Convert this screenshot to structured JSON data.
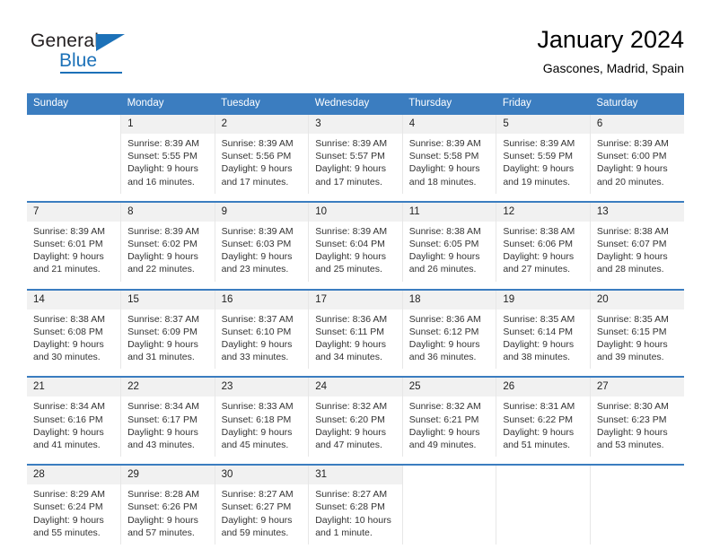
{
  "logo": {
    "word_one": "General",
    "word_two": "Blue"
  },
  "header": {
    "title": "January 2024",
    "subtitle": "Gascones, Madrid, Spain"
  },
  "colors": {
    "header_blue": "#3b7dc0",
    "logo_blue": "#1c71b8",
    "daynum_band": "#f1f1f1",
    "text": "#333333"
  },
  "weekday_headers": [
    "Sunday",
    "Monday",
    "Tuesday",
    "Wednesday",
    "Thursday",
    "Friday",
    "Saturday"
  ],
  "weeks": [
    [
      {
        "day": "",
        "sunrise": "",
        "sunset": "",
        "daylight_line1": "",
        "daylight_line2": ""
      },
      {
        "day": "1",
        "sunrise": "Sunrise: 8:39 AM",
        "sunset": "Sunset: 5:55 PM",
        "daylight_line1": "Daylight: 9 hours",
        "daylight_line2": "and 16 minutes."
      },
      {
        "day": "2",
        "sunrise": "Sunrise: 8:39 AM",
        "sunset": "Sunset: 5:56 PM",
        "daylight_line1": "Daylight: 9 hours",
        "daylight_line2": "and 17 minutes."
      },
      {
        "day": "3",
        "sunrise": "Sunrise: 8:39 AM",
        "sunset": "Sunset: 5:57 PM",
        "daylight_line1": "Daylight: 9 hours",
        "daylight_line2": "and 17 minutes."
      },
      {
        "day": "4",
        "sunrise": "Sunrise: 8:39 AM",
        "sunset": "Sunset: 5:58 PM",
        "daylight_line1": "Daylight: 9 hours",
        "daylight_line2": "and 18 minutes."
      },
      {
        "day": "5",
        "sunrise": "Sunrise: 8:39 AM",
        "sunset": "Sunset: 5:59 PM",
        "daylight_line1": "Daylight: 9 hours",
        "daylight_line2": "and 19 minutes."
      },
      {
        "day": "6",
        "sunrise": "Sunrise: 8:39 AM",
        "sunset": "Sunset: 6:00 PM",
        "daylight_line1": "Daylight: 9 hours",
        "daylight_line2": "and 20 minutes."
      }
    ],
    [
      {
        "day": "7",
        "sunrise": "Sunrise: 8:39 AM",
        "sunset": "Sunset: 6:01 PM",
        "daylight_line1": "Daylight: 9 hours",
        "daylight_line2": "and 21 minutes."
      },
      {
        "day": "8",
        "sunrise": "Sunrise: 8:39 AM",
        "sunset": "Sunset: 6:02 PM",
        "daylight_line1": "Daylight: 9 hours",
        "daylight_line2": "and 22 minutes."
      },
      {
        "day": "9",
        "sunrise": "Sunrise: 8:39 AM",
        "sunset": "Sunset: 6:03 PM",
        "daylight_line1": "Daylight: 9 hours",
        "daylight_line2": "and 23 minutes."
      },
      {
        "day": "10",
        "sunrise": "Sunrise: 8:39 AM",
        "sunset": "Sunset: 6:04 PM",
        "daylight_line1": "Daylight: 9 hours",
        "daylight_line2": "and 25 minutes."
      },
      {
        "day": "11",
        "sunrise": "Sunrise: 8:38 AM",
        "sunset": "Sunset: 6:05 PM",
        "daylight_line1": "Daylight: 9 hours",
        "daylight_line2": "and 26 minutes."
      },
      {
        "day": "12",
        "sunrise": "Sunrise: 8:38 AM",
        "sunset": "Sunset: 6:06 PM",
        "daylight_line1": "Daylight: 9 hours",
        "daylight_line2": "and 27 minutes."
      },
      {
        "day": "13",
        "sunrise": "Sunrise: 8:38 AM",
        "sunset": "Sunset: 6:07 PM",
        "daylight_line1": "Daylight: 9 hours",
        "daylight_line2": "and 28 minutes."
      }
    ],
    [
      {
        "day": "14",
        "sunrise": "Sunrise: 8:38 AM",
        "sunset": "Sunset: 6:08 PM",
        "daylight_line1": "Daylight: 9 hours",
        "daylight_line2": "and 30 minutes."
      },
      {
        "day": "15",
        "sunrise": "Sunrise: 8:37 AM",
        "sunset": "Sunset: 6:09 PM",
        "daylight_line1": "Daylight: 9 hours",
        "daylight_line2": "and 31 minutes."
      },
      {
        "day": "16",
        "sunrise": "Sunrise: 8:37 AM",
        "sunset": "Sunset: 6:10 PM",
        "daylight_line1": "Daylight: 9 hours",
        "daylight_line2": "and 33 minutes."
      },
      {
        "day": "17",
        "sunrise": "Sunrise: 8:36 AM",
        "sunset": "Sunset: 6:11 PM",
        "daylight_line1": "Daylight: 9 hours",
        "daylight_line2": "and 34 minutes."
      },
      {
        "day": "18",
        "sunrise": "Sunrise: 8:36 AM",
        "sunset": "Sunset: 6:12 PM",
        "daylight_line1": "Daylight: 9 hours",
        "daylight_line2": "and 36 minutes."
      },
      {
        "day": "19",
        "sunrise": "Sunrise: 8:35 AM",
        "sunset": "Sunset: 6:14 PM",
        "daylight_line1": "Daylight: 9 hours",
        "daylight_line2": "and 38 minutes."
      },
      {
        "day": "20",
        "sunrise": "Sunrise: 8:35 AM",
        "sunset": "Sunset: 6:15 PM",
        "daylight_line1": "Daylight: 9 hours",
        "daylight_line2": "and 39 minutes."
      }
    ],
    [
      {
        "day": "21",
        "sunrise": "Sunrise: 8:34 AM",
        "sunset": "Sunset: 6:16 PM",
        "daylight_line1": "Daylight: 9 hours",
        "daylight_line2": "and 41 minutes."
      },
      {
        "day": "22",
        "sunrise": "Sunrise: 8:34 AM",
        "sunset": "Sunset: 6:17 PM",
        "daylight_line1": "Daylight: 9 hours",
        "daylight_line2": "and 43 minutes."
      },
      {
        "day": "23",
        "sunrise": "Sunrise: 8:33 AM",
        "sunset": "Sunset: 6:18 PM",
        "daylight_line1": "Daylight: 9 hours",
        "daylight_line2": "and 45 minutes."
      },
      {
        "day": "24",
        "sunrise": "Sunrise: 8:32 AM",
        "sunset": "Sunset: 6:20 PM",
        "daylight_line1": "Daylight: 9 hours",
        "daylight_line2": "and 47 minutes."
      },
      {
        "day": "25",
        "sunrise": "Sunrise: 8:32 AM",
        "sunset": "Sunset: 6:21 PM",
        "daylight_line1": "Daylight: 9 hours",
        "daylight_line2": "and 49 minutes."
      },
      {
        "day": "26",
        "sunrise": "Sunrise: 8:31 AM",
        "sunset": "Sunset: 6:22 PM",
        "daylight_line1": "Daylight: 9 hours",
        "daylight_line2": "and 51 minutes."
      },
      {
        "day": "27",
        "sunrise": "Sunrise: 8:30 AM",
        "sunset": "Sunset: 6:23 PM",
        "daylight_line1": "Daylight: 9 hours",
        "daylight_line2": "and 53 minutes."
      }
    ],
    [
      {
        "day": "28",
        "sunrise": "Sunrise: 8:29 AM",
        "sunset": "Sunset: 6:24 PM",
        "daylight_line1": "Daylight: 9 hours",
        "daylight_line2": "and 55 minutes."
      },
      {
        "day": "29",
        "sunrise": "Sunrise: 8:28 AM",
        "sunset": "Sunset: 6:26 PM",
        "daylight_line1": "Daylight: 9 hours",
        "daylight_line2": "and 57 minutes."
      },
      {
        "day": "30",
        "sunrise": "Sunrise: 8:27 AM",
        "sunset": "Sunset: 6:27 PM",
        "daylight_line1": "Daylight: 9 hours",
        "daylight_line2": "and 59 minutes."
      },
      {
        "day": "31",
        "sunrise": "Sunrise: 8:27 AM",
        "sunset": "Sunset: 6:28 PM",
        "daylight_line1": "Daylight: 10 hours",
        "daylight_line2": "and 1 minute."
      },
      {
        "day": "",
        "sunrise": "",
        "sunset": "",
        "daylight_line1": "",
        "daylight_line2": ""
      },
      {
        "day": "",
        "sunrise": "",
        "sunset": "",
        "daylight_line1": "",
        "daylight_line2": ""
      },
      {
        "day": "",
        "sunrise": "",
        "sunset": "",
        "daylight_line1": "",
        "daylight_line2": ""
      }
    ]
  ]
}
